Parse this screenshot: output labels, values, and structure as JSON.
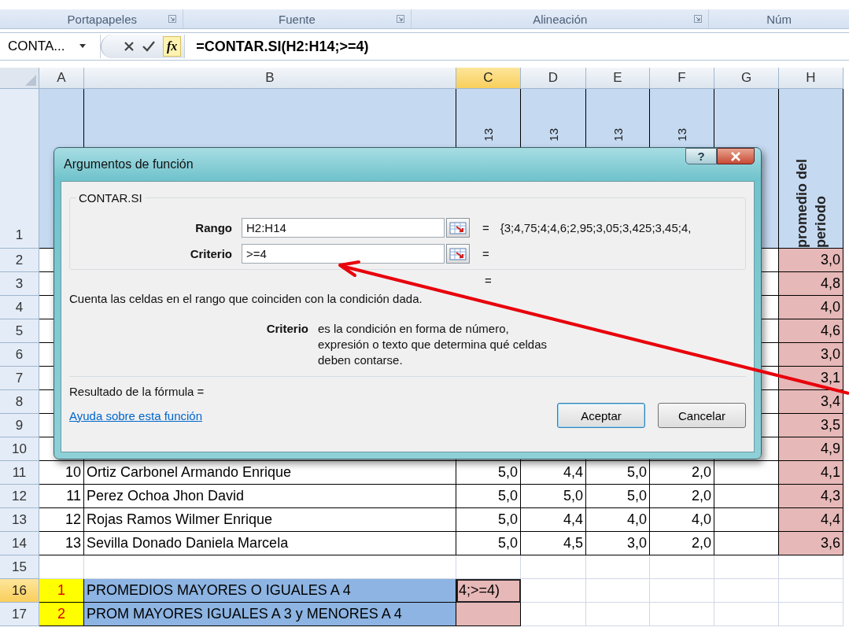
{
  "ribbon_groups": [
    {
      "label": "Portapapeles",
      "launcher": true
    },
    {
      "label": "Fuente",
      "launcher": true
    },
    {
      "label": "Alineación",
      "launcher": true
    },
    {
      "label": "Núm",
      "launcher": false
    }
  ],
  "name_box": "CONTA...",
  "function_glyph": "fx",
  "formula": "=CONTAR.SI(H2:H14;>=4)",
  "columns": [
    {
      "label": "A",
      "selected": false
    },
    {
      "label": "B",
      "selected": false
    },
    {
      "label": "C",
      "selected": true
    },
    {
      "label": "D",
      "selected": false
    },
    {
      "label": "E",
      "selected": false
    },
    {
      "label": "F",
      "selected": false
    },
    {
      "label": "G",
      "selected": false
    },
    {
      "label": "H",
      "selected": false
    }
  ],
  "header_row": {
    "number": "1",
    "selected": false,
    "rotated": [
      "13",
      "13",
      "13",
      "13"
    ],
    "h": "promedio del periodo"
  },
  "rows": [
    {
      "number": "2",
      "selected": false,
      "kind": "hidden",
      "h": "3,0"
    },
    {
      "number": "3",
      "selected": false,
      "kind": "hidden",
      "h": "4,8"
    },
    {
      "number": "4",
      "selected": false,
      "kind": "hidden",
      "h": "4,0"
    },
    {
      "number": "5",
      "selected": false,
      "kind": "hidden",
      "h": "4,6"
    },
    {
      "number": "6",
      "selected": false,
      "kind": "hidden",
      "h": "3,0"
    },
    {
      "number": "7",
      "selected": false,
      "kind": "hidden",
      "h": "3,1"
    },
    {
      "number": "8",
      "selected": false,
      "kind": "hidden",
      "h": "3,4"
    },
    {
      "number": "9",
      "selected": false,
      "kind": "hidden",
      "h": "3,5"
    },
    {
      "number": "10",
      "selected": false,
      "kind": "hidden",
      "h": "4,9"
    },
    {
      "number": "11",
      "selected": false,
      "kind": "student",
      "index": "10",
      "name": "Ortiz Carbonel Armando Enrique",
      "grades": [
        "5,0",
        "4,4",
        "5,0",
        "2,0"
      ],
      "h": "4,1"
    },
    {
      "number": "12",
      "selected": false,
      "kind": "student",
      "index": "11",
      "name": "Perez Ochoa Jhon David",
      "grades": [
        "5,0",
        "5,0",
        "5,0",
        "2,0"
      ],
      "h": "4,3"
    },
    {
      "number": "13",
      "selected": false,
      "kind": "student",
      "index": "12",
      "name": "Rojas Ramos Wilmer Enrique",
      "grades": [
        "5,0",
        "4,4",
        "4,0",
        "4,0"
      ],
      "h": "4,4"
    },
    {
      "number": "14",
      "selected": false,
      "kind": "student",
      "index": "13",
      "name": "Sevilla Donado Daniela Marcela",
      "grades": [
        "5,0",
        "4,5",
        "3,0",
        "2,0"
      ],
      "h": "3,6"
    },
    {
      "number": "15",
      "selected": false,
      "kind": "empty"
    },
    {
      "number": "16",
      "selected": true,
      "kind": "summary",
      "index": "1",
      "label": "PROMEDIOS MAYORES O IGUALES A 4",
      "result": "4;>=4)",
      "active": true
    },
    {
      "number": "17",
      "selected": false,
      "kind": "summary",
      "index": "2",
      "label": "PROM MAYORES IGUALES A 3 y MENORES A 4",
      "active": false
    }
  ],
  "dialog": {
    "title": "Argumentos de función",
    "help_glyph": "?",
    "function_name": "CONTAR.SI",
    "arguments": [
      {
        "label": "Rango",
        "value": "H2:H14",
        "equals": "=",
        "result": "{3;4,75;4;4,6;2,95;3,05;3,425;3,45;4,"
      },
      {
        "label": "Criterio",
        "value": ">=4",
        "equals": "="
      }
    ],
    "total_equals": "=",
    "description": "Cuenta las celdas en el rango que coinciden con la condición dada.",
    "param_name": "Criterio",
    "param_description": "es la condición en forma de número, expresión o texto que determina qué celdas deben contarse.",
    "result_label": "Resultado de la fórmula =",
    "help_link": "Ayuda sobre esta función",
    "buttons": [
      {
        "label": "Aceptar",
        "default": true
      },
      {
        "label": "Cancelar",
        "default": false
      }
    ]
  }
}
